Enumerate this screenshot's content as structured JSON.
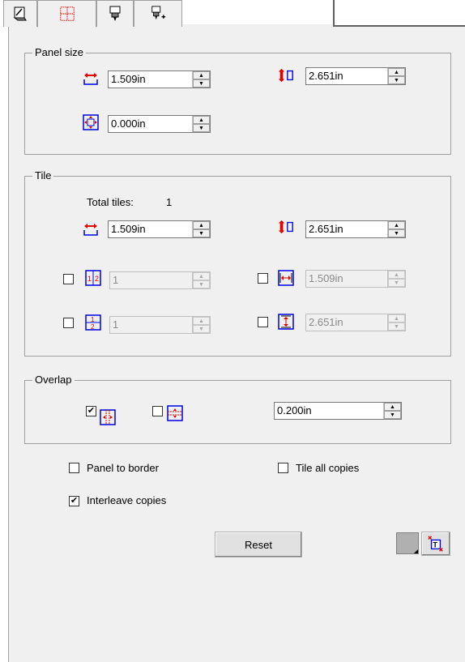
{
  "tabs": [
    {
      "icon": "page-setup-icon"
    },
    {
      "icon": "tiling-grid-icon",
      "active": true
    },
    {
      "icon": "cutter-icon"
    },
    {
      "icon": "cutter-add-icon"
    }
  ],
  "panel_size": {
    "title": "Panel size",
    "width": {
      "value": "1.509in",
      "icon": "width-arrow-icon"
    },
    "height": {
      "value": "2.651in",
      "icon": "height-arrow-icon"
    },
    "margin": {
      "value": "0.000in",
      "icon": "margin-icon"
    }
  },
  "tile": {
    "title": "Tile",
    "total_label": "Total tiles:",
    "total_value": "1",
    "width": {
      "value": "1.509in"
    },
    "height": {
      "value": "2.651in"
    },
    "columns": {
      "value": "1",
      "checked": false
    },
    "column_width": {
      "value": "1.509in",
      "checked": false
    },
    "rows": {
      "value": "1",
      "checked": false
    },
    "row_height": {
      "value": "2.651in",
      "checked": false
    }
  },
  "overlap": {
    "title": "Overlap",
    "horizontal_checked": true,
    "vertical_checked": false,
    "value": "0.200in"
  },
  "options": {
    "panel_to_border": {
      "label": "Panel to border",
      "checked": false
    },
    "tile_all_copies": {
      "label": "Tile all copies",
      "checked": false
    },
    "interleave_copies": {
      "label": "Interleave copies",
      "checked": true
    }
  },
  "reset_label": "Reset",
  "colors": {
    "accent_red": "#e00000",
    "accent_blue": "#0000e0"
  }
}
